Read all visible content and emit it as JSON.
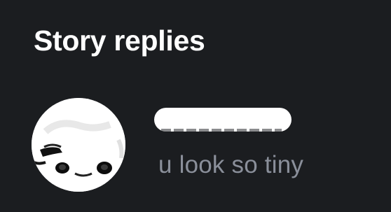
{
  "section": {
    "title": "Story replies"
  },
  "reply": {
    "avatar_icon": "profile-avatar",
    "username_redacted": true,
    "message": "u look so tiny"
  },
  "colors": {
    "background": "#1b1d20",
    "title": "#ffffff",
    "message": "#8a8f9a",
    "redaction": "#ffffff"
  }
}
